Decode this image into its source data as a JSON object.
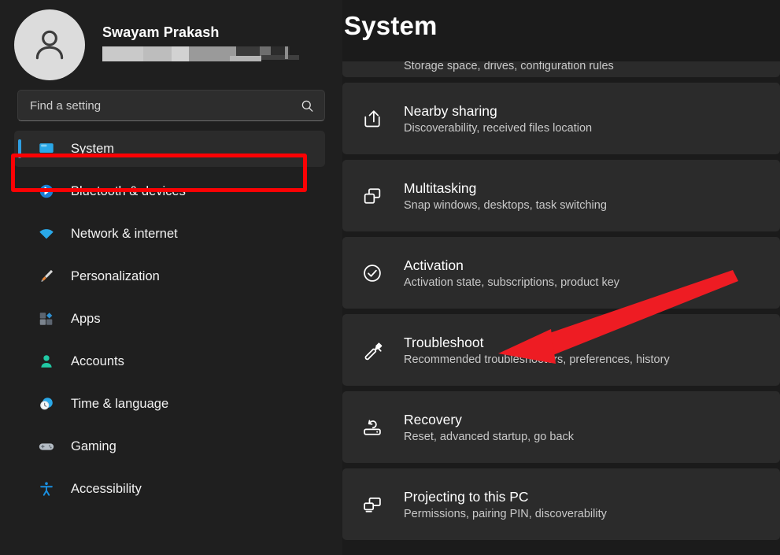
{
  "sidebar": {
    "profile": {
      "name": "Swayam Prakash",
      "email_redacted": true,
      "avatar_icon": "person-avatar-icon"
    },
    "search": {
      "placeholder": "Find a setting",
      "value": "",
      "icon": "search-icon"
    },
    "items": [
      {
        "label": "System",
        "icon": "monitor-icon",
        "selected": true,
        "icon_color": "#2aa8e8"
      },
      {
        "label": "Bluetooth & devices",
        "icon": "bluetooth-icon",
        "selected": false,
        "icon_color": "#1a7fd4"
      },
      {
        "label": "Network & internet",
        "icon": "wifi-icon",
        "selected": false,
        "icon_color": "#2aa8e8"
      },
      {
        "label": "Personalization",
        "icon": "paintbrush-icon",
        "selected": false,
        "icon_color": "#e08a2e"
      },
      {
        "label": "Apps",
        "icon": "apps-grid-icon",
        "selected": false,
        "icon_color": "#6f7a85"
      },
      {
        "label": "Accounts",
        "icon": "person-icon",
        "selected": false,
        "icon_color": "#21c9a4"
      },
      {
        "label": "Time & language",
        "icon": "clock-globe-icon",
        "selected": false,
        "icon_color": "#2aa8e8"
      },
      {
        "label": "Gaming",
        "icon": "gamepad-icon",
        "selected": false,
        "icon_color": "#a8b0b8"
      },
      {
        "label": "Accessibility",
        "icon": "accessibility-icon",
        "selected": false,
        "icon_color": "#1a8fe0"
      }
    ]
  },
  "main": {
    "title": "System",
    "rows": [
      {
        "title": "",
        "subtitle": "Storage space, drives, configuration rules",
        "icon": "storage-icon",
        "clipped": true
      },
      {
        "title": "Nearby sharing",
        "subtitle": "Discoverability, received files location",
        "icon": "share-icon",
        "clipped": false
      },
      {
        "title": "Multitasking",
        "subtitle": "Snap windows, desktops, task switching",
        "icon": "multitask-icon",
        "clipped": false
      },
      {
        "title": "Activation",
        "subtitle": "Activation state, subscriptions, product key",
        "icon": "check-circle-icon",
        "clipped": false
      },
      {
        "title": "Troubleshoot",
        "subtitle": "Recommended troubleshooters, preferences, history",
        "icon": "wrench-icon",
        "clipped": false
      },
      {
        "title": "Recovery",
        "subtitle": "Reset, advanced startup, go back",
        "icon": "recovery-icon",
        "clipped": false
      },
      {
        "title": "Projecting to this PC",
        "subtitle": "Permissions, pairing PIN, discoverability",
        "icon": "project-screen-icon",
        "clipped": false
      }
    ]
  },
  "annotations": {
    "highlight_color": "#fb0204",
    "highlight_target": "System",
    "arrow_color": "#ee1c23",
    "arrow_target": "Troubleshoot"
  }
}
